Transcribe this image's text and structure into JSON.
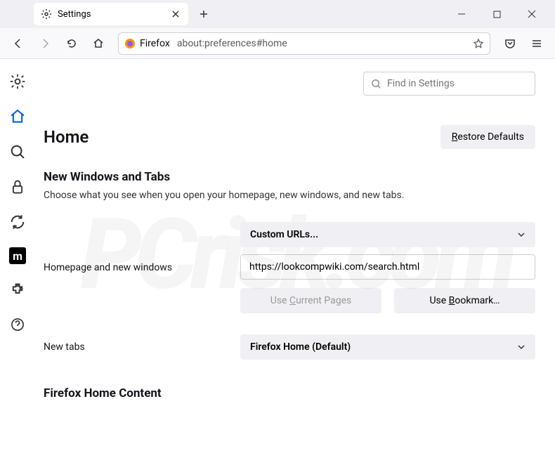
{
  "tab": {
    "title": "Settings"
  },
  "urlbar": {
    "label": "Firefox",
    "url": "about:preferences#home"
  },
  "search": {
    "placeholder": "Find in Settings"
  },
  "page": {
    "title": "Home",
    "restore": "Restore Defaults",
    "section1_title": "New Windows and Tabs",
    "section1_desc": "Choose what you see when you open your homepage, new windows, and new tabs.",
    "homepage_label": "Homepage and new windows",
    "homepage_dropdown": "Custom URLs...",
    "homepage_value": "https://lookcompwiki.com/search.html",
    "use_current": "Use Current Pages",
    "use_bookmark": "Use Bookmark…",
    "newtabs_label": "New tabs",
    "newtabs_dropdown": "Firefox Home (Default)",
    "section2_title": "Firefox Home Content"
  }
}
